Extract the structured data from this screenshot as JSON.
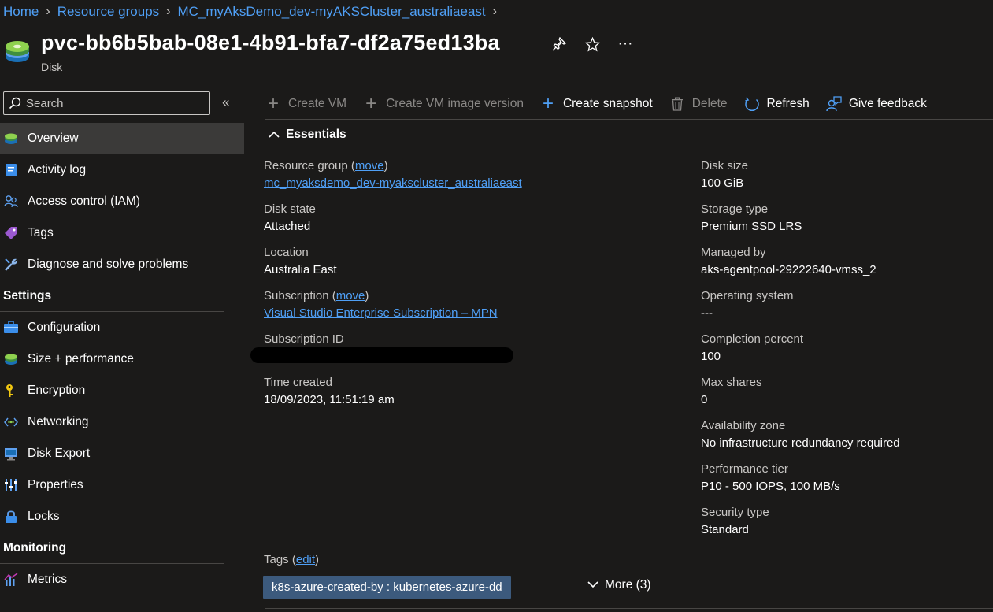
{
  "breadcrumb": [
    "Home",
    "Resource groups",
    "MC_myAksDemo_dev-myAKSCluster_australiaeast"
  ],
  "title": "pvc-bb6b5bab-08e1-4b91-bfa7-df2a75ed13ba",
  "subtitle": "Disk",
  "title_actions": {
    "pin": "pin-icon",
    "favorite": "star-icon",
    "more": "···"
  },
  "search": {
    "placeholder": "Search",
    "collapse": "«"
  },
  "nav": {
    "items": [
      {
        "label": "Overview",
        "icon": "disk-icon",
        "active": true
      },
      {
        "label": "Activity log",
        "icon": "activity-log-icon"
      },
      {
        "label": "Access control (IAM)",
        "icon": "iam-icon"
      },
      {
        "label": "Tags",
        "icon": "tag-icon"
      },
      {
        "label": "Diagnose and solve problems",
        "icon": "wrench-icon"
      }
    ],
    "settings_header": "Settings",
    "settings": [
      {
        "label": "Configuration",
        "icon": "configuration-icon"
      },
      {
        "label": "Size + performance",
        "icon": "disk-icon"
      },
      {
        "label": "Encryption",
        "icon": "key-icon"
      },
      {
        "label": "Networking",
        "icon": "networking-icon"
      },
      {
        "label": "Disk Export",
        "icon": "export-icon"
      },
      {
        "label": "Properties",
        "icon": "properties-icon"
      },
      {
        "label": "Locks",
        "icon": "lock-icon"
      }
    ],
    "monitoring_header": "Monitoring",
    "monitoring": [
      {
        "label": "Metrics",
        "icon": "metrics-icon"
      }
    ]
  },
  "toolbar": {
    "create_vm": "Create VM",
    "create_vm_image": "Create VM image version",
    "create_snapshot": "Create snapshot",
    "delete": "Delete",
    "refresh": "Refresh",
    "feedback": "Give feedback"
  },
  "essentials": {
    "header": "Essentials",
    "left": {
      "resource_group_label": "Resource group",
      "move_label": "move",
      "resource_group_value": "mc_myaksdemo_dev-myakscluster_australiaeast",
      "disk_state_label": "Disk state",
      "disk_state_value": "Attached",
      "location_label": "Location",
      "location_value": "Australia East",
      "subscription_label": "Subscription",
      "subscription_value": "Visual Studio Enterprise Subscription – MPN",
      "subscription_id_label": "Subscription ID",
      "time_created_label": "Time created",
      "time_created_value": "18/09/2023, 11:51:19 am"
    },
    "right": {
      "disk_size_label": "Disk size",
      "disk_size_value": "100 GiB",
      "storage_type_label": "Storage type",
      "storage_type_value": "Premium SSD LRS",
      "managed_by_label": "Managed by",
      "managed_by_value": "aks-agentpool-29222640-vmss_2",
      "os_label": "Operating system",
      "os_value": "---",
      "completion_label": "Completion percent",
      "completion_value": "100",
      "max_shares_label": "Max shares",
      "max_shares_value": "0",
      "zone_label": "Availability zone",
      "zone_value": "No infrastructure redundancy required",
      "tier_label": "Performance tier",
      "tier_value": "P10 - 500 IOPS, 100 MB/s",
      "security_label": "Security type",
      "security_value": "Standard"
    }
  },
  "tags": {
    "label": "Tags",
    "edit": "edit",
    "chip": "k8s-azure-created-by : kubernetes-azure-dd",
    "more": "More (3)"
  }
}
